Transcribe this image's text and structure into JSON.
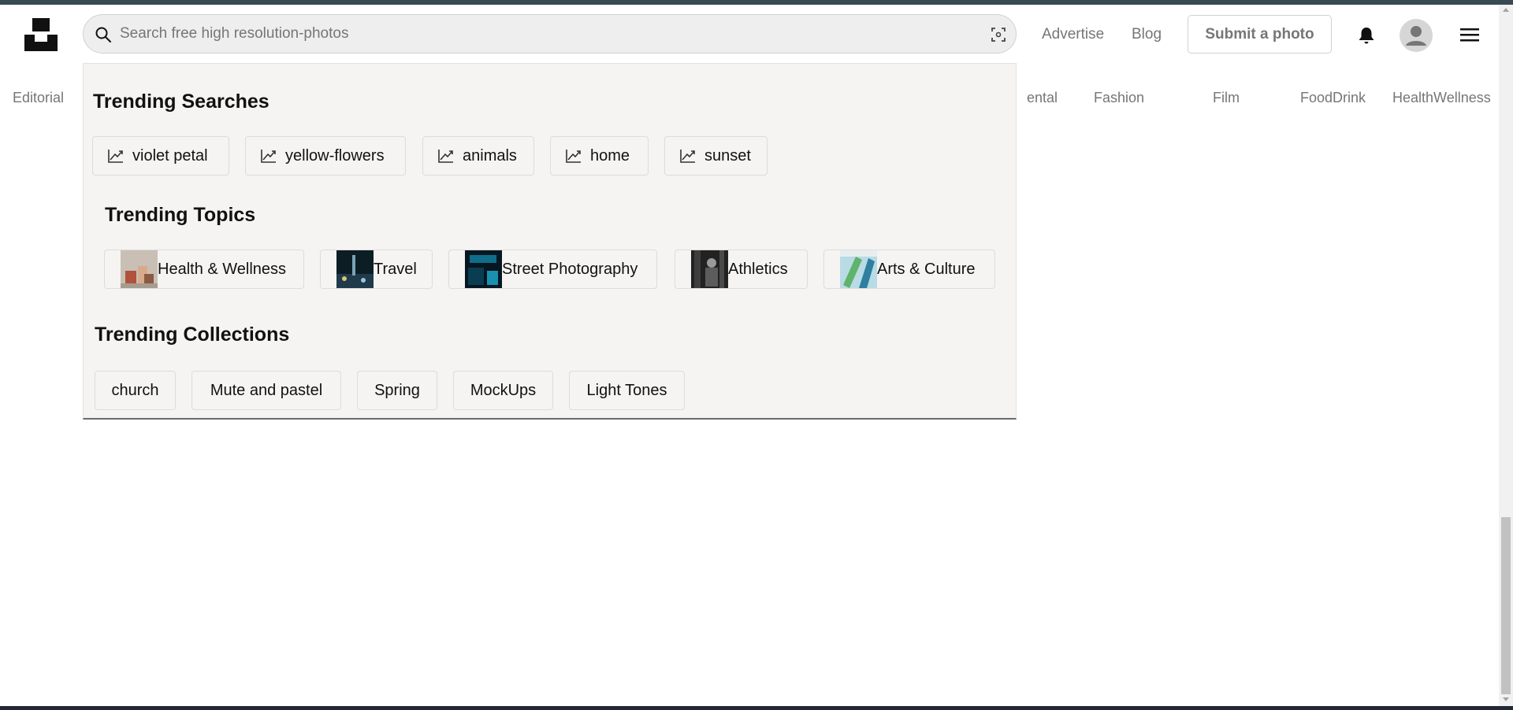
{
  "header": {
    "search": {
      "placeholder": "Search free high resolution-photos",
      "value": ""
    },
    "nav": {
      "advertise": "Advertise",
      "blog": "Blog"
    },
    "submit_label": "Submit a photo"
  },
  "topics_nav": {
    "items": [
      "Editorial",
      "ental",
      "Fashion",
      "Film",
      "FoodDrink",
      "HealthWellness"
    ]
  },
  "dropdown": {
    "trending_searches": {
      "title": "Trending Searches",
      "items": [
        "violet petal",
        "yellow-flowers",
        "animals",
        "home",
        "sunset"
      ]
    },
    "trending_topics": {
      "title": "Trending Topics",
      "items": [
        "Health & Wellness",
        "Travel",
        "Street Photography",
        "Athletics",
        "Arts & Culture"
      ]
    },
    "trending_collections": {
      "title": "Trending Collections",
      "items": [
        "church",
        "Mute and pastel",
        "Spring",
        "MockUps",
        "Light Tones"
      ]
    }
  },
  "colors": {
    "muted_text": "#767676",
    "dropdown_bg": "#f5f4f2",
    "search_bg": "#eeeeee",
    "border": "#d1d1d1"
  }
}
